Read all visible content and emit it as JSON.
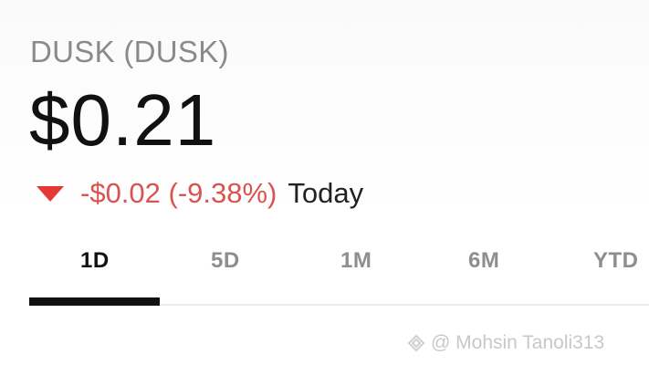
{
  "asset": {
    "name": "DUSK (DUSK)",
    "price": "$0.21"
  },
  "change": {
    "text": "-$0.02 (-9.38%)",
    "period": "Today",
    "direction_icon": "triangle-down-icon",
    "color": "#d9534f"
  },
  "tabs": [
    {
      "label": "1D",
      "active": true
    },
    {
      "label": "5D",
      "active": false
    },
    {
      "label": "1M",
      "active": false
    },
    {
      "label": "6M",
      "active": false
    },
    {
      "label": "YTD",
      "active": false
    }
  ],
  "watermark": {
    "icon": "diamond-logo-icon",
    "text": "@ Mohsin Tanoli313"
  },
  "colors": {
    "accent": "#111111",
    "negative": "#e53935",
    "muted": "#8e8e8e"
  }
}
